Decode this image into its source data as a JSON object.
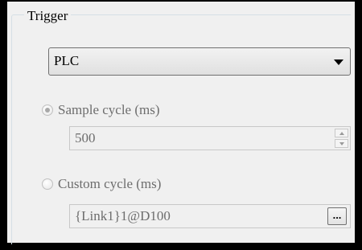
{
  "group": {
    "title": "Trigger"
  },
  "trigger_select": {
    "value": "PLC"
  },
  "sample": {
    "label": "Sample cycle (ms)",
    "checked": true,
    "value": "500"
  },
  "custom": {
    "label": "Custom cycle (ms)",
    "checked": false,
    "value": "{Link1}1@D100",
    "browse_label": "..."
  },
  "icons": {
    "dropdown": "chevron-down-icon",
    "spin_up": "spin-up-icon",
    "spin_down": "spin-down-icon"
  },
  "colors": {
    "background": "#f0f0f0",
    "border_dark": "#000000",
    "disabled_text": "#6d6d6d",
    "groupbox_border": "#d5dfe5"
  }
}
